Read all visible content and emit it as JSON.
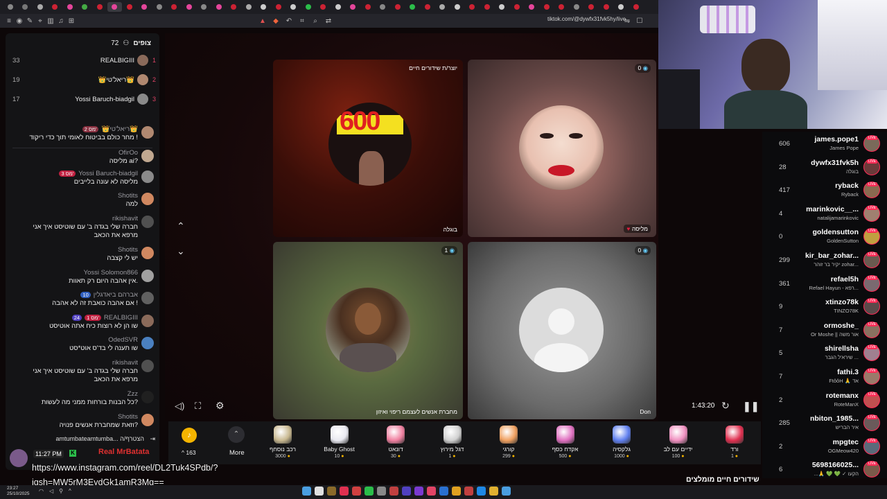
{
  "browser": {
    "url": "tiktok.com/@dywfx31fvk5hy/live",
    "tab_colors": [
      "#888",
      "#777",
      "#aaa",
      "#c23",
      "#e4459a",
      "#4a4",
      "#c23",
      "#e4459a",
      "#c23",
      "#e4459a",
      "#888",
      "#c23",
      "#e4459a",
      "#888",
      "#e4459a",
      "#c23",
      "#aaa",
      "#ccc",
      "#c23",
      "#ccc",
      "#2bbd4a",
      "#c23",
      "#ccc",
      "#e4459a",
      "#c23",
      "#888",
      "#c23",
      "#2bbd4a",
      "#c23",
      "#aaa",
      "#ccc",
      "#c23",
      "#c23",
      "#ccc",
      "#c23",
      "#e4459a",
      "#c23",
      "#c23",
      "#888",
      "#c23",
      "#c23",
      "#ccc",
      "#c23"
    ]
  },
  "chat": {
    "viewers_label": "צופים",
    "viewers_count": "72",
    "leaders": [
      {
        "count": "33",
        "name": "REALBIGIII",
        "rank": "1",
        "color": "#8a6a5a"
      },
      {
        "count": "19",
        "name": "👑ריאל'טי👑",
        "rank": "2",
        "color": "#b08870"
      },
      {
        "count": "17",
        "name": "Yossi Baruch-biadgil",
        "rank": "3",
        "color": "#8a8a8a"
      }
    ],
    "messages": [
      {
        "user": "👑ריאל'טי👑",
        "badge": "2 מס'",
        "badge_color": "#8a3040",
        "text": "מחר כולם בביטוח לאומי תוך כדי ריקוד !",
        "color": "#b08870"
      },
      {
        "user": "OfirOo",
        "text": "מליסה ai?",
        "color": "#c0a890"
      },
      {
        "user": "Yossi Baruch-biadgil",
        "badge": "3 מס'",
        "badge_color": "#c02040",
        "text": "מליסה לא עונה בלייבים",
        "color": "#8a8a8a"
      },
      {
        "user": "Shotits",
        "text": "למה",
        "color": "#d08860"
      },
      {
        "user": "rikishavit",
        "text": "חברה שלי בגדה ב' עם שוטיסט איך אני",
        "text2": "מרפא את הכאב",
        "color": "#505050"
      },
      {
        "user": "Shotits",
        "text": "יש לי קצבה",
        "color": "#d08860"
      },
      {
        "user": "Yossi Solomon866",
        "text": "אין אהבה היום רק תאוות.",
        "color": "#a0a0a0"
      },
      {
        "user": "אברהם ביאדגלין",
        "badge": "10",
        "badge_color": "#3060c0",
        "text": "אם אהבה כואבת זה לא אהבה !",
        "color": "#606060"
      },
      {
        "user": "REALBIGIII",
        "badge": "24",
        "badge_color": "#5040c0",
        "badge2": "1 מס'",
        "text": "שו הן לא רוצות כיח אתה אוטיסט",
        "color": "#8a6a5a"
      },
      {
        "user": "OdedSVR",
        "text": "שו תענה לי בד'ס אוט*סט",
        "color": "#4a80c0"
      },
      {
        "user": "rikishavit",
        "text": "חברה שלי בגדה ב' עם שוטיסט איך אני",
        "text2": "מרפא את הכאב",
        "color": "#505050"
      },
      {
        "user": "Zzz",
        "text": "כל הבנות בורחות ממני מה לעשות?",
        "color": "#202020"
      },
      {
        "user": "Shotits",
        "text": "וזאת שמחברת אנשים פנויה?",
        "color": "#d08860"
      }
    ],
    "input_text": "amtumbateamtumba... הצטרף/ה",
    "overlay_time": "11:27 PM",
    "overlay_name": "Real MrBatata",
    "overlay_url": "https://www.instagram.com/reel/DL2Tuk4SPdb/?",
    "overlay_url2": "igsh=MW5rM3EydGk1amR3Mg=="
  },
  "stream": {
    "tile1_top_label": "יוצר/ת שידורים חיים",
    "tile1_name": "בוגלה",
    "tile2_count": "0",
    "tile2_name": "מליסה",
    "tile3_count": "1",
    "tile3_name": "מחברת אנשים לעצמם ריפוי ואיזון",
    "tile4_count": "0",
    "tile4_name": "Don",
    "poster_number": "600",
    "timer": "1:43:20"
  },
  "gifts": {
    "coins": "163",
    "more_label": "More",
    "items": [
      {
        "name": "רכב נוסחף",
        "price": "3000",
        "color": "#c8b890"
      },
      {
        "name": "Baby Ghost",
        "price": "10",
        "color": "#e8e8f0"
      },
      {
        "name": "דונאט",
        "price": "30",
        "color": "#f080a0"
      },
      {
        "name": "דגל מירוץ",
        "price": "1",
        "color": "#d0d0d0"
      },
      {
        "name": "קורגי",
        "price": "299",
        "color": "#f0a060"
      },
      {
        "name": "אקדח כסף",
        "price": "500",
        "color": "#e070c0"
      },
      {
        "name": "גלקסיה",
        "price": "1000",
        "color": "#6080f0"
      },
      {
        "name": "ידיים עם לב",
        "price": "100",
        "color": "#f090c0"
      },
      {
        "name": "ורד",
        "price": "1",
        "color": "#e03050"
      }
    ],
    "bottom_title": "שידורים חיים מומלצים"
  },
  "right_list": [
    {
      "count": "606",
      "user": "james.pope1",
      "display": "James Pope",
      "color": "#7a6a5a"
    },
    {
      "count": "28",
      "user": "dywfx31fvk5h",
      "display": "בוגלה",
      "color": "#6a3a3a"
    },
    {
      "count": "417",
      "user": "ryback",
      "display": "Ryback",
      "color": "#8a6a50"
    },
    {
      "count": "4",
      "user": "marinkovic__...",
      "display": "natalijamarinkovic",
      "color": "#a08070"
    },
    {
      "count": "0",
      "user": "goldensutton",
      "display": "GoldenSutton",
      "color": "#c0a040"
    },
    {
      "count": "299",
      "user": "kir_bar_zohar...",
      "display": "יקיר בר זוהר zohar...",
      "color": "#6a5a50"
    },
    {
      "count": "361",
      "user": "refael5h",
      "display": "Refael Hayun - רפא...",
      "color": "#7a6a70"
    },
    {
      "count": "9",
      "user": "xtinzo78k",
      "display": "TINZO78K",
      "color": "#5a4a4a"
    },
    {
      "count": "7",
      "user": "ormoshe_",
      "display": "Or Moshe || אור משה",
      "color": "#8a7060"
    },
    {
      "count": "5",
      "user": "shirellsha",
      "display": "שירא'ל הגבר ...",
      "color": "#a08090"
    },
    {
      "count": "7",
      "user": "fathi.3",
      "display": "FtôôH 🙏 אד",
      "color": "#9a7a6a"
    },
    {
      "count": "2",
      "user": "rotemanx",
      "display": "RoteManX",
      "color": "#c05050"
    },
    {
      "count": "285",
      "user": "nbiton_1985...",
      "display": "איר הבריש",
      "color": "#6a5a5a"
    },
    {
      "count": "2",
      "user": "mpgtec",
      "display": "OGMeow420",
      "color": "#5a6a7a"
    },
    {
      "count": "6",
      "user": "5698166025...",
      "display": "...🙏 💚 💚 ✓ הקעו",
      "color": "#7a5a4a"
    }
  ],
  "taskbar": {
    "time": "23:27",
    "date": "25/10/2025",
    "icon_colors": [
      "#4a9ee0",
      "#e0e0e0",
      "#8a6a2a",
      "#e03050",
      "#d04040",
      "#2bbd4a",
      "#888",
      "#c04040",
      "#5040c0",
      "#7a3ad0",
      "#e04466",
      "#2a70d0",
      "#e0a020",
      "#c04040",
      "#1e88e5",
      "#e0b030",
      "#4a9ee0"
    ]
  }
}
